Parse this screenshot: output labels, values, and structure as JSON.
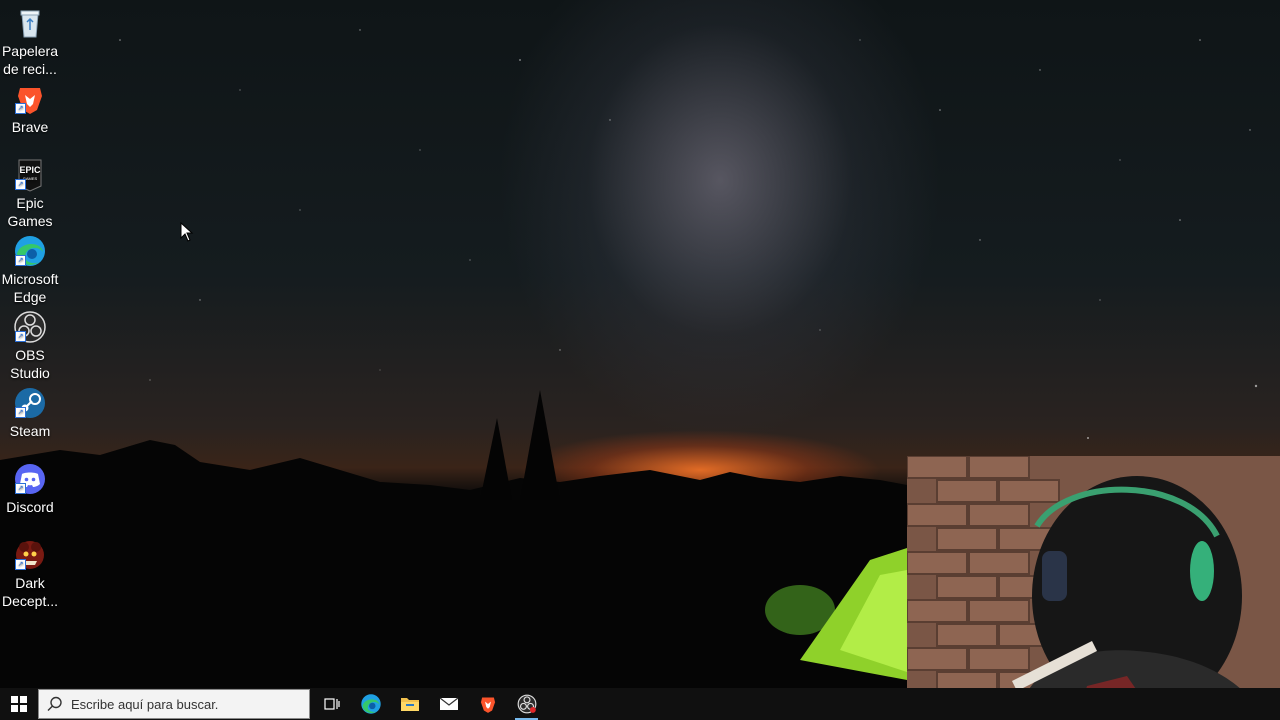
{
  "desktop": {
    "icons": [
      {
        "name": "recycle-bin",
        "label": "Papelera\nde reci...",
        "icon": "recycle-bin-icon"
      },
      {
        "name": "brave",
        "label": "Brave",
        "icon": "brave-lion-icon"
      },
      {
        "name": "epic-games",
        "label": "Epic\nGames ...",
        "icon": "epic-games-icon"
      },
      {
        "name": "microsoft-edge",
        "label": "Microsoft\nEdge",
        "icon": "edge-icon"
      },
      {
        "name": "obs-studio",
        "label": "OBS\nStudio",
        "icon": "obs-icon"
      },
      {
        "name": "steam",
        "label": "Steam",
        "icon": "steam-icon"
      },
      {
        "name": "discord",
        "label": "Discord",
        "icon": "discord-icon"
      },
      {
        "name": "dark-deception",
        "label": "Dark\nDecept...",
        "icon": "dark-deception-icon"
      }
    ]
  },
  "taskbar": {
    "search_placeholder": "Escribe aquí para buscar.",
    "buttons": [
      {
        "name": "task-view",
        "icon": "task-view-icon"
      },
      {
        "name": "edge",
        "icon": "edge-icon"
      },
      {
        "name": "file-explorer",
        "icon": "folder-icon"
      },
      {
        "name": "mail",
        "icon": "mail-icon"
      },
      {
        "name": "brave",
        "icon": "brave-lion-icon"
      },
      {
        "name": "obs",
        "icon": "obs-icon",
        "active": true
      }
    ]
  },
  "colors": {
    "taskbar_bg": "#101010",
    "active_indicator": "#76b9ed",
    "discord": "#5865f2",
    "brave": "#fb542b",
    "steam": "#1b6aa5"
  }
}
